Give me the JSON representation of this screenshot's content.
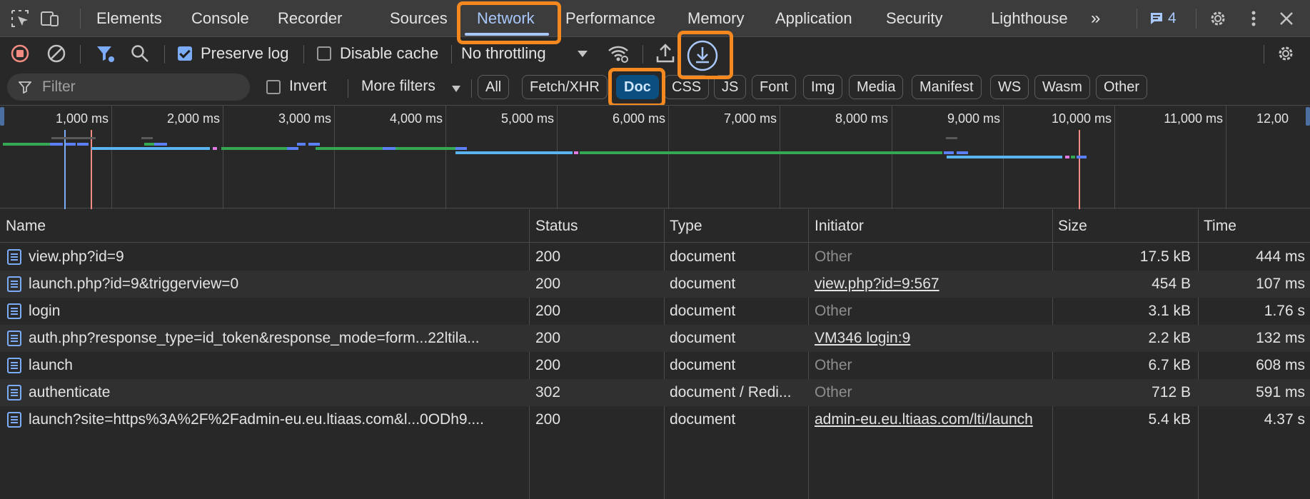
{
  "tabs": [
    {
      "label": "Elements"
    },
    {
      "label": "Console"
    },
    {
      "label": "Recorder"
    },
    {
      "label": "Sources"
    },
    {
      "label": "Network"
    },
    {
      "label": "Performance"
    },
    {
      "label": "Memory"
    },
    {
      "label": "Application"
    },
    {
      "label": "Security"
    },
    {
      "label": "Lighthouse"
    }
  ],
  "active_tab": "Network",
  "issues_count": "4",
  "toolbar": {
    "preserve_log_label": "Preserve log",
    "preserve_log_checked": true,
    "disable_cache_label": "Disable cache",
    "disable_cache_checked": false,
    "throttling_value": "No throttling"
  },
  "filter": {
    "placeholder": "Filter",
    "invert_label": "Invert",
    "more_filters_label": "More filters",
    "types": [
      "All",
      "Fetch/XHR",
      "Doc",
      "CSS",
      "JS",
      "Font",
      "Img",
      "Media",
      "Manifest",
      "WS",
      "Wasm",
      "Other"
    ],
    "active_type": "Doc"
  },
  "overview": {
    "ticks": [
      "1,000 ms",
      "2,000 ms",
      "3,000 ms",
      "4,000 ms",
      "5,000 ms",
      "6,000 ms",
      "7,000 ms",
      "8,000 ms",
      "9,000 ms",
      "10,000 ms",
      "11,000 ms",
      "12,00"
    ]
  },
  "table": {
    "columns": [
      "Name",
      "Status",
      "Type",
      "Initiator",
      "Size",
      "Time"
    ],
    "rows": [
      {
        "name": "view.php?id=9",
        "status": "200",
        "type": "document",
        "initiator": "Other",
        "initiator_link": false,
        "size": "17.5 kB",
        "time": "444 ms"
      },
      {
        "name": "launch.php?id=9&triggerview=0",
        "status": "200",
        "type": "document",
        "initiator": "view.php?id=9:567",
        "initiator_link": true,
        "size": "454 B",
        "time": "107 ms"
      },
      {
        "name": "login",
        "status": "200",
        "type": "document",
        "initiator": "Other",
        "initiator_link": false,
        "size": "3.1 kB",
        "time": "1.76 s"
      },
      {
        "name": "auth.php?response_type=id_token&response_mode=form...22ltila...",
        "status": "200",
        "type": "document",
        "initiator": "VM346 login:9",
        "initiator_link": true,
        "size": "2.2 kB",
        "time": "132 ms"
      },
      {
        "name": "launch",
        "status": "200",
        "type": "document",
        "initiator": "Other",
        "initiator_link": false,
        "size": "6.7 kB",
        "time": "608 ms"
      },
      {
        "name": "authenticate",
        "status": "302",
        "type": "document / Redi...",
        "initiator": "Other",
        "initiator_link": false,
        "size": "712 B",
        "time": "591 ms"
      },
      {
        "name": "launch?site=https%3A%2F%2Fadmin-eu.eu.ltiaas.com&l...0ODh9....",
        "status": "200",
        "type": "document",
        "initiator": "admin-eu.eu.ltiaas.com/lti/launch",
        "initiator_link": true,
        "size": "5.4 kB",
        "time": "4.37 s"
      }
    ]
  },
  "colors": {
    "accent": "#a8c7fa",
    "highlight": "#f5891f",
    "record": "#f28b82",
    "doc_active": "#0b4f80"
  }
}
